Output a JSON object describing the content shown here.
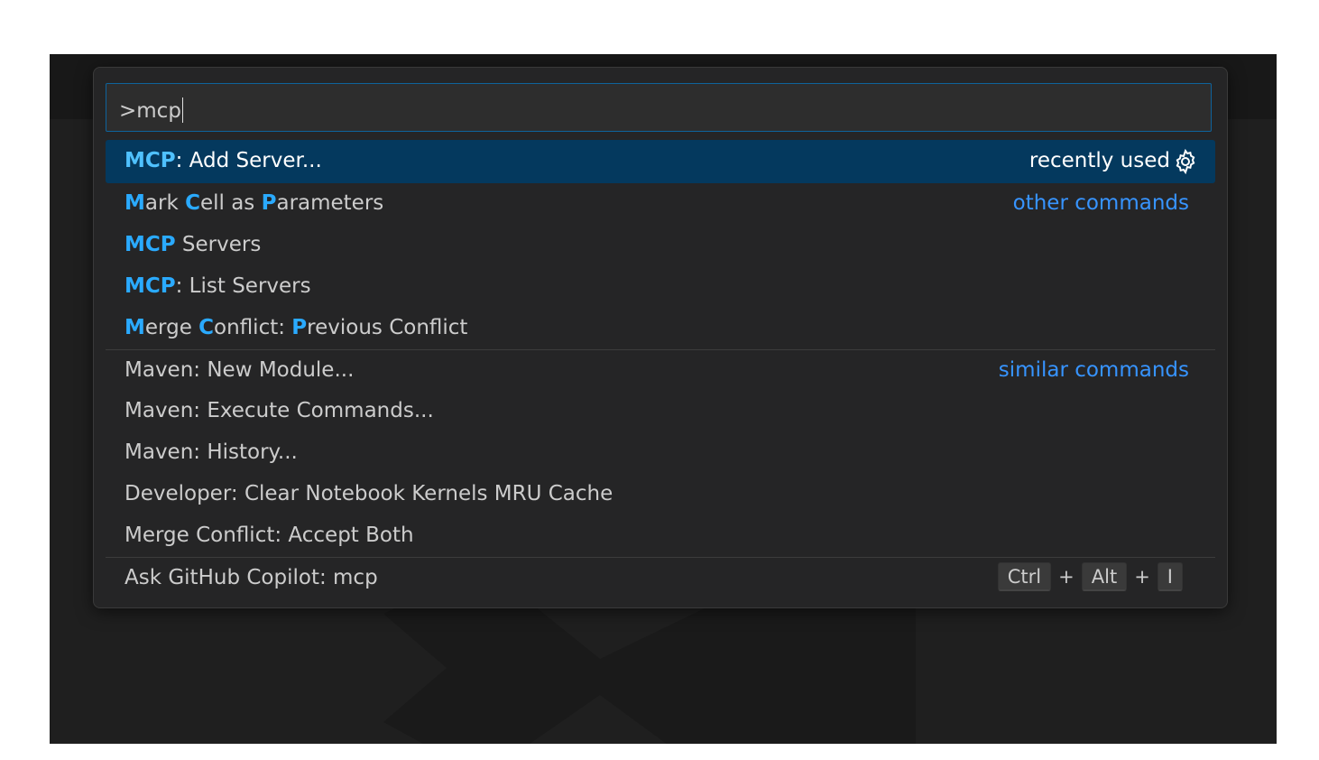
{
  "command_palette": {
    "input_value": ">mcp",
    "groups": [
      {
        "label": "recently used",
        "items": [
          {
            "parts": [
              {
                "t": "MCP",
                "h": true
              },
              {
                "t": ": Add Server...",
                "h": false
              }
            ],
            "selected": true
          }
        ]
      },
      {
        "label": "other commands",
        "items": [
          {
            "parts": [
              {
                "t": "M",
                "h": true
              },
              {
                "t": "ark ",
                "h": false
              },
              {
                "t": "C",
                "h": true
              },
              {
                "t": "ell as ",
                "h": false
              },
              {
                "t": "P",
                "h": true
              },
              {
                "t": "arameters",
                "h": false
              }
            ]
          },
          {
            "parts": [
              {
                "t": "MCP",
                "h": true
              },
              {
                "t": " Servers",
                "h": false
              }
            ]
          },
          {
            "parts": [
              {
                "t": "MCP",
                "h": true
              },
              {
                "t": ": List Servers",
                "h": false
              }
            ]
          },
          {
            "parts": [
              {
                "t": "M",
                "h": true
              },
              {
                "t": "erge ",
                "h": false
              },
              {
                "t": "C",
                "h": true
              },
              {
                "t": "onflict: ",
                "h": false
              },
              {
                "t": "P",
                "h": true
              },
              {
                "t": "revious Conflict",
                "h": false
              }
            ]
          }
        ]
      },
      {
        "label": "similar commands",
        "items": [
          {
            "parts": [
              {
                "t": "Maven: New Module...",
                "h": false
              }
            ]
          },
          {
            "parts": [
              {
                "t": "Maven: Execute Commands...",
                "h": false
              }
            ]
          },
          {
            "parts": [
              {
                "t": "Maven: History...",
                "h": false
              }
            ]
          },
          {
            "parts": [
              {
                "t": "Developer: Clear Notebook Kernels MRU Cache",
                "h": false
              }
            ]
          },
          {
            "parts": [
              {
                "t": "Merge Conflict: Accept Both",
                "h": false
              }
            ]
          }
        ]
      },
      {
        "label": "",
        "items": [
          {
            "parts": [
              {
                "t": "Ask GitHub Copilot: mcp",
                "h": false
              }
            ],
            "keybinding": [
              "Ctrl",
              "Alt",
              "I"
            ]
          }
        ]
      }
    ],
    "gear_icon": "gear-icon",
    "colors": {
      "accent": "#0e639c",
      "highlight": "#2aaaff",
      "selection": "#04395e",
      "group_label": "#3794ff"
    }
  }
}
